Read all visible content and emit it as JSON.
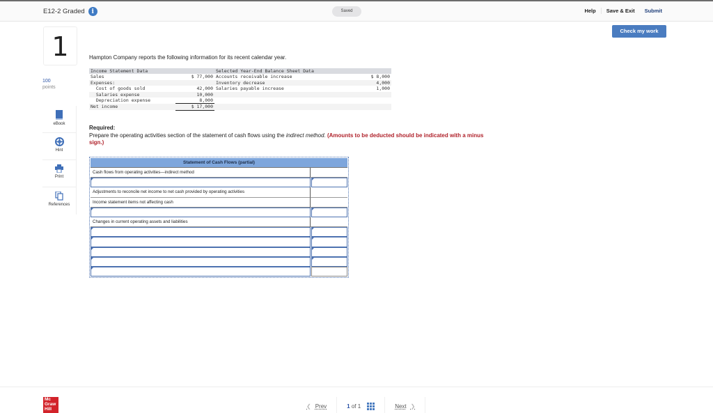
{
  "header": {
    "title": "E12-2 Graded",
    "status": "Saved",
    "help": "Help",
    "save_exit": "Save & Exit",
    "submit": "Submit",
    "check_my_work": "Check my work"
  },
  "question": {
    "number": "1",
    "points_value": "100",
    "points_label": "points",
    "intro": "Hampton Company reports the following information for its recent calendar year."
  },
  "tools": [
    {
      "label": "eBook",
      "icon": "book-icon"
    },
    {
      "label": "Hint",
      "icon": "lifebuoy-icon"
    },
    {
      "label": "Print",
      "icon": "printer-icon"
    },
    {
      "label": "References",
      "icon": "documents-icon"
    }
  ],
  "data_table": {
    "income_header": "Income Statement Data",
    "balance_header": "Selected Year-End Balance Sheet Data",
    "rows": [
      {
        "left_label": "Sales",
        "left_value": "$ 77,000",
        "right_label": "Accounts receivable increase",
        "right_value": "$ 8,000"
      },
      {
        "left_label": "Expenses:",
        "left_value": "",
        "right_label": "Inventory decrease",
        "right_value": "4,000"
      },
      {
        "left_label": "  Cost of goods sold",
        "left_value": "42,000",
        "right_label": "Salaries payable increase",
        "right_value": "1,000"
      },
      {
        "left_label": "  Salaries expense",
        "left_value": "10,000",
        "right_label": "",
        "right_value": ""
      },
      {
        "left_label": "  Depreciation expense",
        "left_value": "8,000",
        "right_label": "",
        "right_value": ""
      },
      {
        "left_label": "Net income",
        "left_value": "$ 17,000",
        "right_label": "",
        "right_value": ""
      }
    ]
  },
  "required": {
    "heading": "Required:",
    "text": "Prepare the operating activities section of the statement of cash flows using the ",
    "method": "indirect method",
    "period": ". ",
    "note": "(Amounts to be deducted should be indicated with a minus sign.)"
  },
  "statement": {
    "title": "Statement of Cash Flows (partial)",
    "rows": [
      {
        "type": "label",
        "text": "Cash flows from operating activities—indirect method"
      },
      {
        "type": "input",
        "text": "",
        "amount": ""
      },
      {
        "type": "label",
        "text": "Adjustments to reconcile net income to net cash provided by operating activities"
      },
      {
        "type": "label",
        "text": "Income statement items not affecting cash"
      },
      {
        "type": "input",
        "text": "",
        "amount": ""
      },
      {
        "type": "label",
        "text": "Changes in current operating assets and liabilities"
      },
      {
        "type": "input",
        "text": "",
        "amount": ""
      },
      {
        "type": "input",
        "text": "",
        "amount": ""
      },
      {
        "type": "input",
        "text": "",
        "amount": ""
      },
      {
        "type": "input",
        "text": "",
        "amount": ""
      },
      {
        "type": "input-total",
        "text": "",
        "amount": ""
      }
    ]
  },
  "footer": {
    "logo_lines": [
      "Mc",
      "Graw",
      "Hill"
    ],
    "prev": "Prev",
    "current_page": "1",
    "of_label": "of 1",
    "next": "Next"
  }
}
